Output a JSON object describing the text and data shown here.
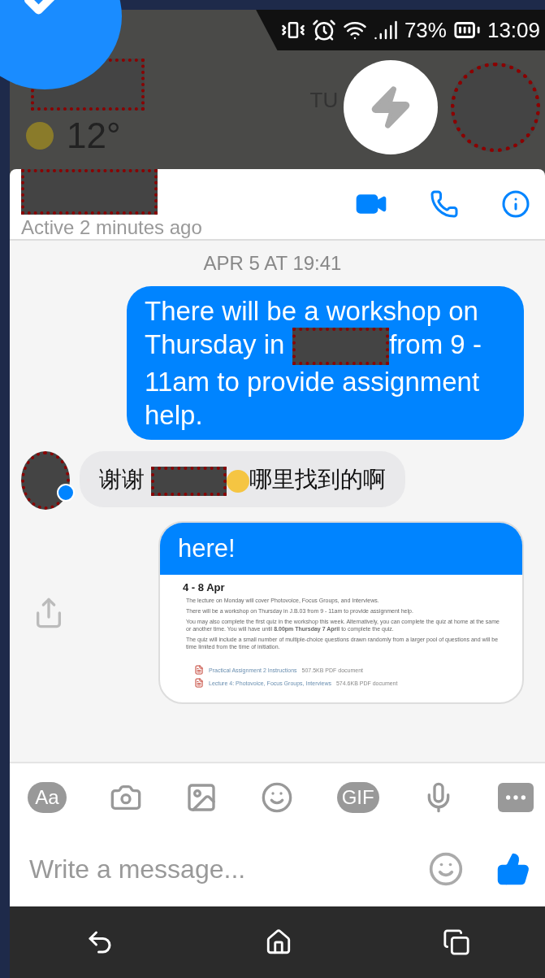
{
  "status_bar": {
    "battery": "73%",
    "time": "13:09"
  },
  "weather_widget": {
    "temperature": "12°",
    "day": "TU"
  },
  "chat": {
    "status": "Active 2 minutes ago",
    "date_divider": "APR 5 AT 19:41",
    "messages": [
      {
        "kind": "outgoing_text",
        "segments": [
          {
            "kind": "text",
            "text": "There will be a workshop on Thursday in"
          },
          {
            "kind": "redacted"
          },
          {
            "kind": "text",
            "text": "from 9 - 11am to provide assignment help."
          }
        ]
      },
      {
        "kind": "incoming_text",
        "segments": [
          {
            "kind": "text",
            "text": "谢谢"
          },
          {
            "kind": "redacted"
          },
          {
            "kind": "emoji"
          },
          {
            "kind": "text",
            "text": "哪里找到的啊"
          }
        ]
      },
      {
        "kind": "outgoing_attachment",
        "segments": [
          {
            "kind": "text",
            "text": "here!"
          }
        ],
        "document": {
          "title": "4 - 8 Apr",
          "paragraphs": [
            "The lecture on Monday will cover Photovoice, Focus Groups, and Interviews.",
            "There will be a workshop on Thursday in J.B.03 from 9 - 11am to provide assignment help.",
            "You may also complete the first quiz in the workshop this week. Alternatively, you can complete the quiz at home at the same or another time. You will have until **8.00pm Thursday 7 April** to complete the quiz.",
            "The quiz will include a small number of multiple-choice questions drawn randomly from a larger pool of questions and will be time limited from the time of initiation."
          ],
          "files": [
            {
              "name": "Practical Assignment 2 Instructions",
              "meta": "507.5KB PDF document"
            },
            {
              "name": "Lecture 4: Photovoice, Focus Groups, Interviews",
              "meta": "574.6KB PDF document"
            }
          ]
        }
      }
    ]
  },
  "composer": {
    "toolbar": [
      {
        "kind": "text",
        "label": "Aa"
      },
      {
        "kind": "camera"
      },
      {
        "kind": "image"
      },
      {
        "kind": "emoji"
      },
      {
        "kind": "text",
        "label": "GIF"
      },
      {
        "kind": "mic"
      },
      {
        "kind": "more"
      }
    ],
    "placeholder": "Write a message..."
  }
}
